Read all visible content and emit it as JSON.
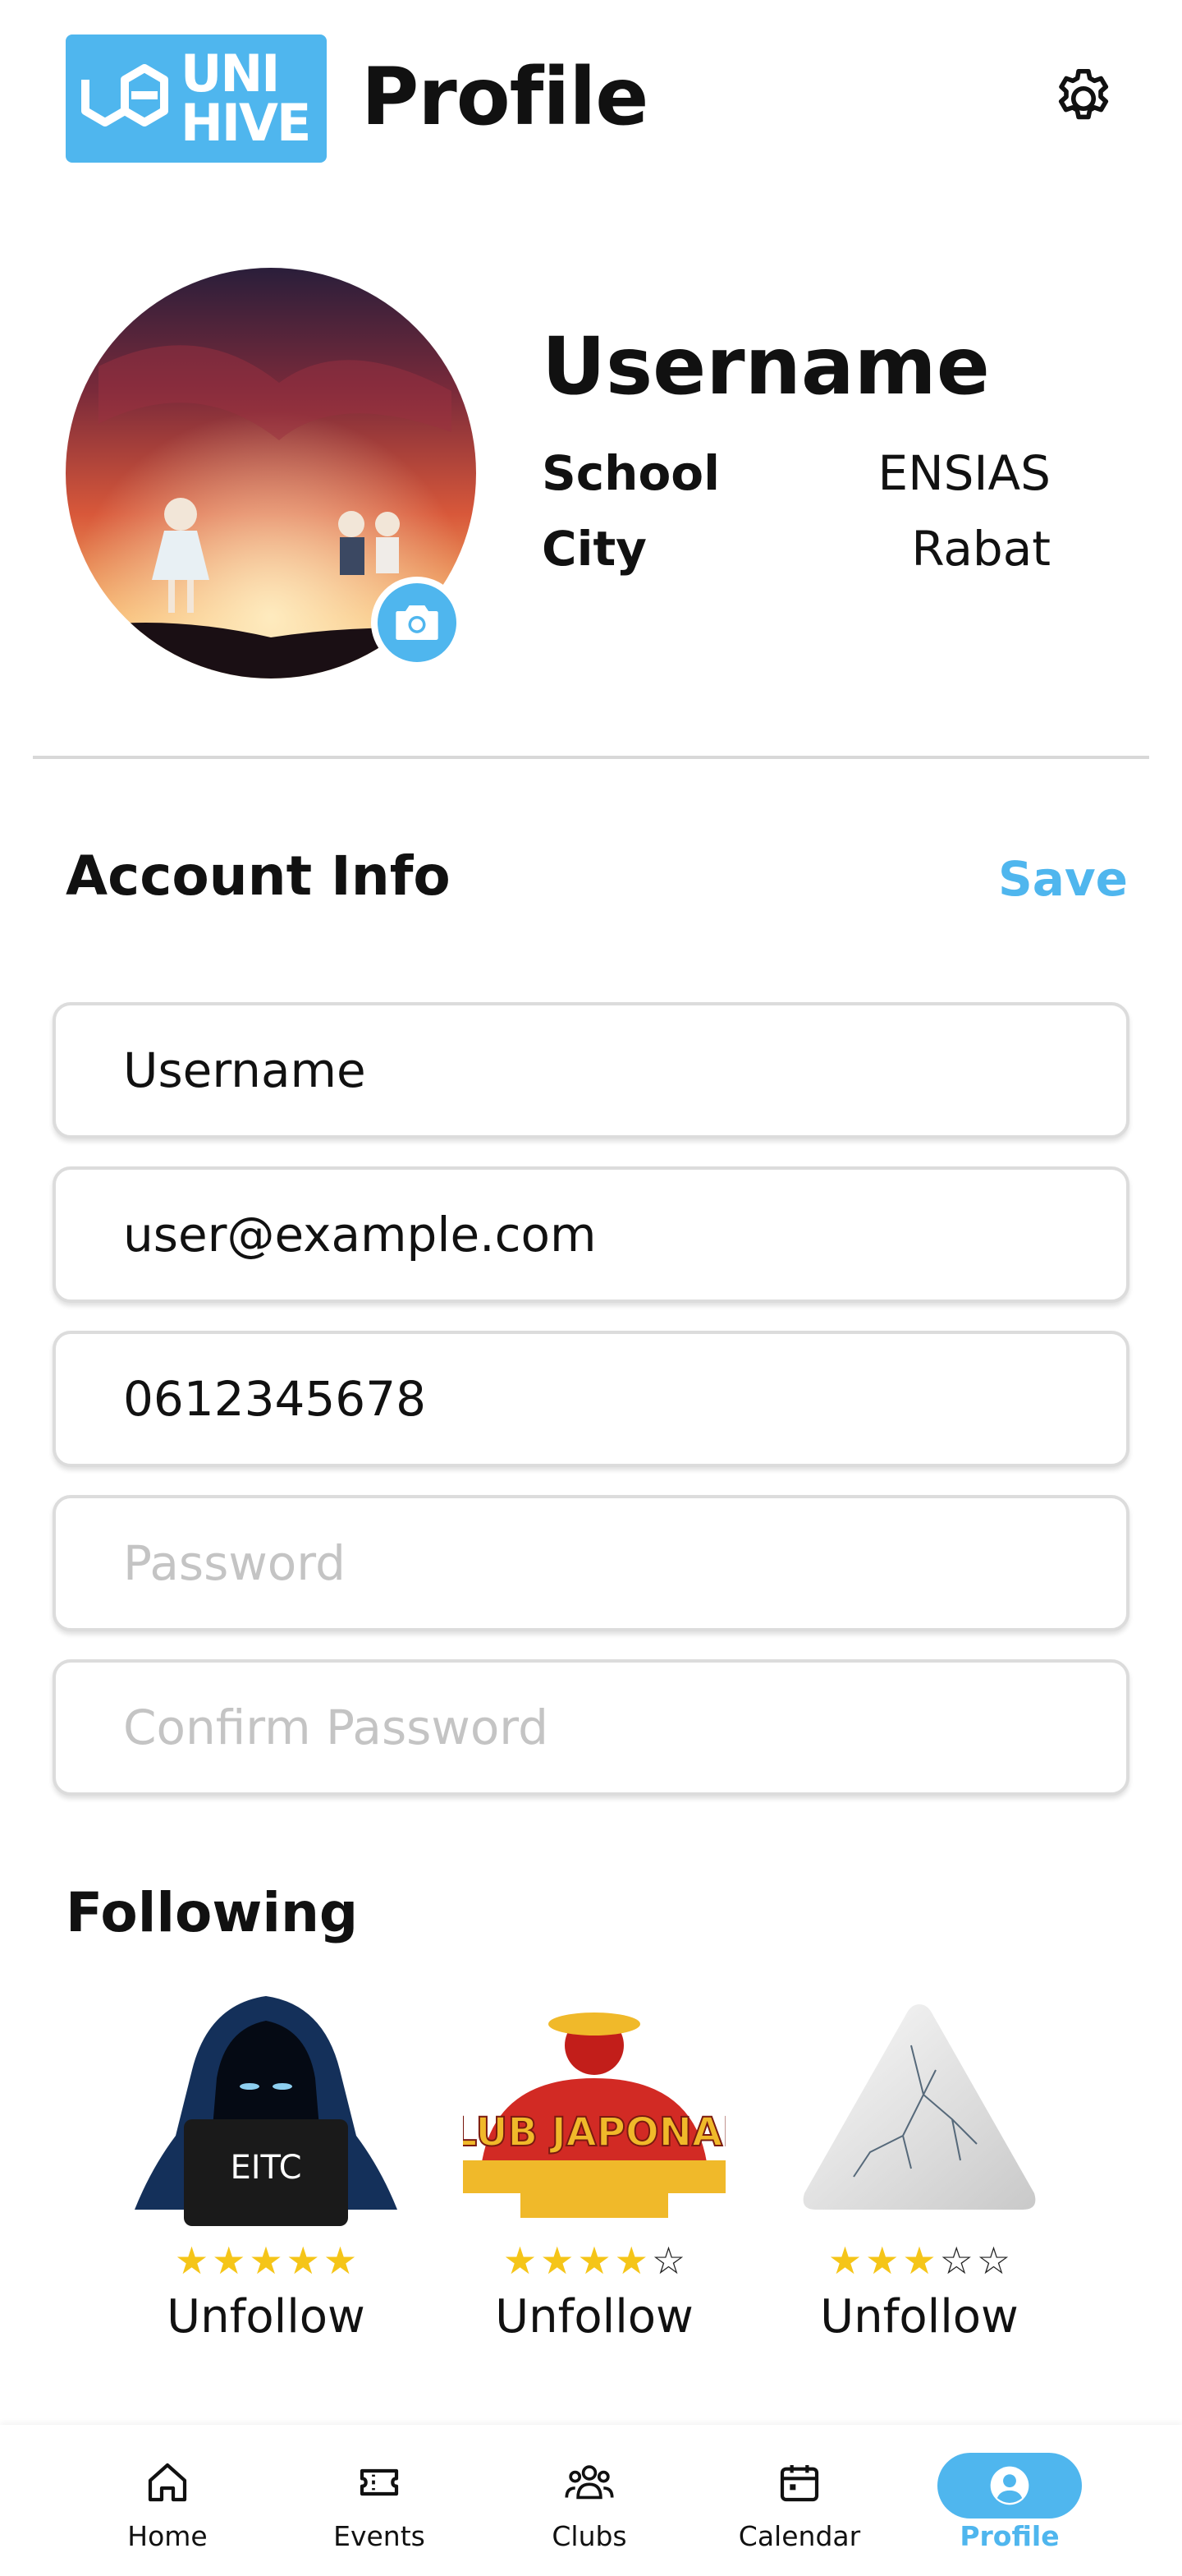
{
  "header": {
    "logo_text_line1": "UNI",
    "logo_text_line2": "HIVE",
    "title": "Profile",
    "settings_icon": "gear-icon"
  },
  "profile": {
    "username": "Username",
    "school_label": "School",
    "school_value": "ENSIAS",
    "city_label": "City",
    "city_value": "Rabat",
    "camera_icon": "camera-icon"
  },
  "account": {
    "title": "Account Info",
    "save_label": "Save",
    "fields": {
      "username": {
        "value": "Username",
        "placeholder": ""
      },
      "email": {
        "value": "user@example.com",
        "placeholder": ""
      },
      "phone": {
        "value": "0612345678",
        "placeholder": ""
      },
      "password": {
        "value": "",
        "placeholder": "Password"
      },
      "confirm_password": {
        "value": "",
        "placeholder": "Confirm Password"
      }
    }
  },
  "following": {
    "title": "Following",
    "clubs": [
      {
        "rating": 5,
        "max": 5,
        "button": "Unfollow",
        "logo_text": "EITC"
      },
      {
        "rating": 4,
        "max": 5,
        "button": "Unfollow",
        "logo_text": "CLUB JAPONAIS"
      },
      {
        "rating": 3,
        "max": 5,
        "button": "Unfollow"
      }
    ]
  },
  "nav": {
    "items": [
      {
        "label": "Home",
        "icon": "home-icon"
      },
      {
        "label": "Events",
        "icon": "ticket-icon"
      },
      {
        "label": "Clubs",
        "icon": "users-icon"
      },
      {
        "label": "Calendar",
        "icon": "calendar-icon"
      },
      {
        "label": "Profile",
        "icon": "profile-icon",
        "active": true
      }
    ]
  },
  "colors": {
    "accent": "#4fb6ee",
    "star": "#f5c518"
  }
}
